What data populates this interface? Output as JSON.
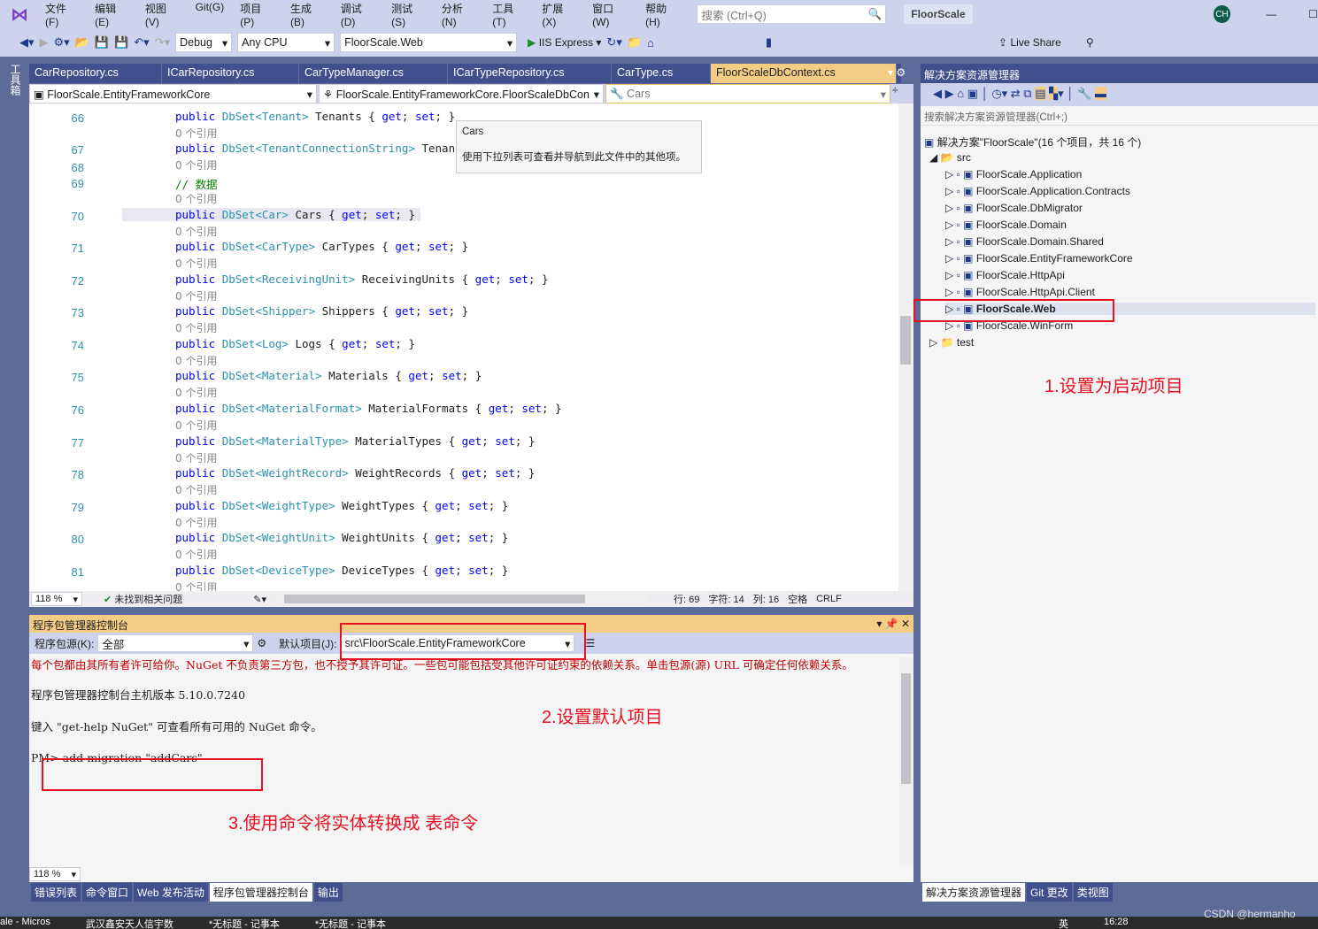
{
  "menu": [
    "文件(F)",
    "编辑(E)",
    "视图(V)",
    "Git(G)",
    "项目(P)",
    "生成(B)",
    "调试(D)",
    "测试(S)",
    "分析(N)",
    "工具(T)",
    "扩展(X)",
    "窗口(W)",
    "帮助(H)"
  ],
  "search_placeholder": "搜索 (Ctrl+Q)",
  "solution_name": "FloorScale",
  "avatar": "CH",
  "toolbar": {
    "config": "Debug",
    "platform": "Any CPU",
    "startup": "FloorScale.Web",
    "run": "IIS Express",
    "live_share": "Live Share"
  },
  "toolbox_label": "工具箱",
  "tabs": [
    "CarRepository.cs",
    "ICarRepository.cs",
    "CarTypeManager.cs",
    "ICarTypeRepository.cs",
    "CarType.cs",
    "FloorScaleDbContext.cs"
  ],
  "nav": {
    "project": "FloorScale.EntityFrameworkCore",
    "class": "FloorScale.EntityFrameworkCore.FloorScaleDbCon",
    "member": "Cars"
  },
  "tooltip": {
    "title": "Cars",
    "body": "使用下拉列表可查看并导航到此文件中的其他项。"
  },
  "ref_text": "0 个引用",
  "code_lines": [
    {
      "n": "66",
      "type": "DbSet<Tenant>",
      "name": "Tenants"
    },
    {
      "n": "67",
      "type": "DbSet<TenantConnectionString>",
      "name": "Tenan"
    },
    {
      "n": "68"
    },
    {
      "n": "69",
      "comment": "// 数据"
    },
    {
      "n": "70",
      "type": "DbSet<Car>",
      "name": "Cars"
    },
    {
      "n": "71",
      "type": "DbSet<CarType>",
      "name": "CarTypes"
    },
    {
      "n": "72",
      "type": "DbSet<ReceivingUnit>",
      "name": "ReceivingUnits"
    },
    {
      "n": "73",
      "type": "DbSet<Shipper>",
      "name": "Shippers"
    },
    {
      "n": "74",
      "type": "DbSet<Log>",
      "name": "Logs"
    },
    {
      "n": "75",
      "type": "DbSet<Material>",
      "name": "Materials"
    },
    {
      "n": "76",
      "type": "DbSet<MaterialFormat>",
      "name": "MaterialFormats"
    },
    {
      "n": "77",
      "type": "DbSet<MaterialType>",
      "name": "MaterialTypes"
    },
    {
      "n": "78",
      "type": "DbSet<WeightRecord>",
      "name": "WeightRecords"
    },
    {
      "n": "79",
      "type": "DbSet<WeightType>",
      "name": "WeightTypes"
    },
    {
      "n": "80",
      "type": "DbSet<WeightUnit>",
      "name": "WeightUnits"
    },
    {
      "n": "81",
      "type": "DbSet<DeviceType>",
      "name": "DeviceTypes"
    }
  ],
  "status": {
    "zoom": "118 %",
    "issues": "未找到相关问题",
    "line": "行: 69",
    "char": "字符: 14",
    "col": "列: 16",
    "space": "空格",
    "eol": "CRLF"
  },
  "pmc": {
    "title": "程序包管理器控制台",
    "source_label": "程序包源(K):",
    "source": "全部",
    "default_label": "默认项目(J):",
    "default": "src\\FloorScale.EntityFrameworkCore",
    "lines": [
      "每个包都由其所有者许可给你。NuGet 不负责第三方包，也不授予其许可证。一些包可能包括受其他许可证约束的依赖关系。单击包源(源) URL 可确定任何依赖关系。",
      "程序包管理器控制台主机版本 5.10.0.7240",
      "键入 \"get-help NuGet\" 可查看所有可用的 NuGet 命令。"
    ],
    "prompt": "PM>",
    "command": "add-migration \"addCars\"",
    "zoom": "118 %"
  },
  "bottom_tabs": [
    "错误列表",
    "命令窗口",
    "Web 发布活动",
    "程序包管理器控制台",
    "输出"
  ],
  "se": {
    "title": "解决方案资源管理器",
    "search": "搜索解决方案资源管理器(Ctrl+;)",
    "solution": "解决方案\"FloorScale\"(16 个项目，共 16 个)",
    "src": "src",
    "projects": [
      "FloorScale.Application",
      "FloorScale.Application.Contracts",
      "FloorScale.DbMigrator",
      "FloorScale.Domain",
      "FloorScale.Domain.Shared",
      "FloorScale.EntityFrameworkCore",
      "FloorScale.HttpApi",
      "FloorScale.HttpApi.Client",
      "FloorScale.Web",
      "FloorScale.WinForm"
    ],
    "test": "test",
    "tabs": [
      "解决方案资源管理器",
      "Git 更改",
      "类视图"
    ]
  },
  "annotations": [
    "1.设置为启动项目",
    "2.设置默认项目",
    "3.使用命令将实体转换成 表命令"
  ],
  "taskbar": [
    "ale - Micros",
    "武汉鑫安天人信宇数",
    "*无标题 - 记事本",
    "*无标题 - 记事本"
  ],
  "clock": "16:28",
  "ime": "英",
  "watermark": "CSDN @hermanho"
}
